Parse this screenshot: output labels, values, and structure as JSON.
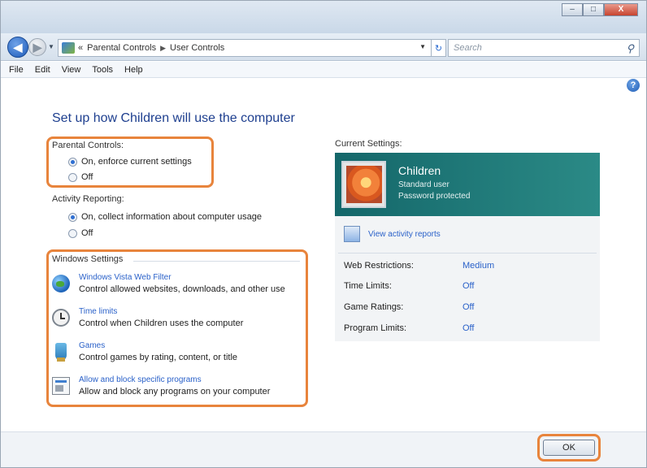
{
  "window": {
    "controls": {
      "minimize": "–",
      "maximize": "□",
      "close": "X"
    }
  },
  "navigation": {
    "back_icon": "back-arrow-icon",
    "forward_icon": "forward-arrow-icon",
    "breadcrumb": [
      "Parental Controls",
      "User Controls"
    ],
    "breadcrumb_prefix": "«",
    "search_placeholder": "Search"
  },
  "menu": [
    "File",
    "Edit",
    "View",
    "Tools",
    "Help"
  ],
  "page": {
    "title": "Set up how Children will use the computer"
  },
  "parental_controls": {
    "label": "Parental Controls:",
    "options": [
      {
        "label": "On, enforce current settings",
        "selected": true
      },
      {
        "label": "Off",
        "selected": false
      }
    ]
  },
  "activity_reporting": {
    "label": "Activity Reporting:",
    "options": [
      {
        "label": "On, collect information about computer usage",
        "selected": true
      },
      {
        "label": "Off",
        "selected": false
      }
    ]
  },
  "windows_settings": {
    "label": "Windows Settings",
    "items": [
      {
        "icon": "globe-icon",
        "link": "Windows Vista Web Filter",
        "description": "Control allowed websites, downloads, and other use"
      },
      {
        "icon": "clock-icon",
        "link": "Time limits",
        "description": "Control when Children uses the computer"
      },
      {
        "icon": "trophy-icon",
        "link": "Games",
        "description": "Control games by rating, content, or title"
      },
      {
        "icon": "program-icon",
        "link": "Allow and block specific programs",
        "description": "Allow and block any programs on your computer"
      }
    ]
  },
  "current_settings": {
    "label": "Current Settings:",
    "user_name": "Children",
    "account_type": "Standard user",
    "password_status": "Password protected",
    "report_link": "View activity reports",
    "rows": [
      {
        "key": "Web Restrictions:",
        "value": "Medium"
      },
      {
        "key": "Time Limits:",
        "value": "Off"
      },
      {
        "key": "Game Ratings:",
        "value": "Off"
      },
      {
        "key": "Program Limits:",
        "value": "Off"
      }
    ]
  },
  "footer": {
    "ok_label": "OK"
  },
  "colors": {
    "highlight": "#e8843c",
    "link": "#2a61c9",
    "card": "#1e7a78",
    "title": "#1e3f8f"
  }
}
